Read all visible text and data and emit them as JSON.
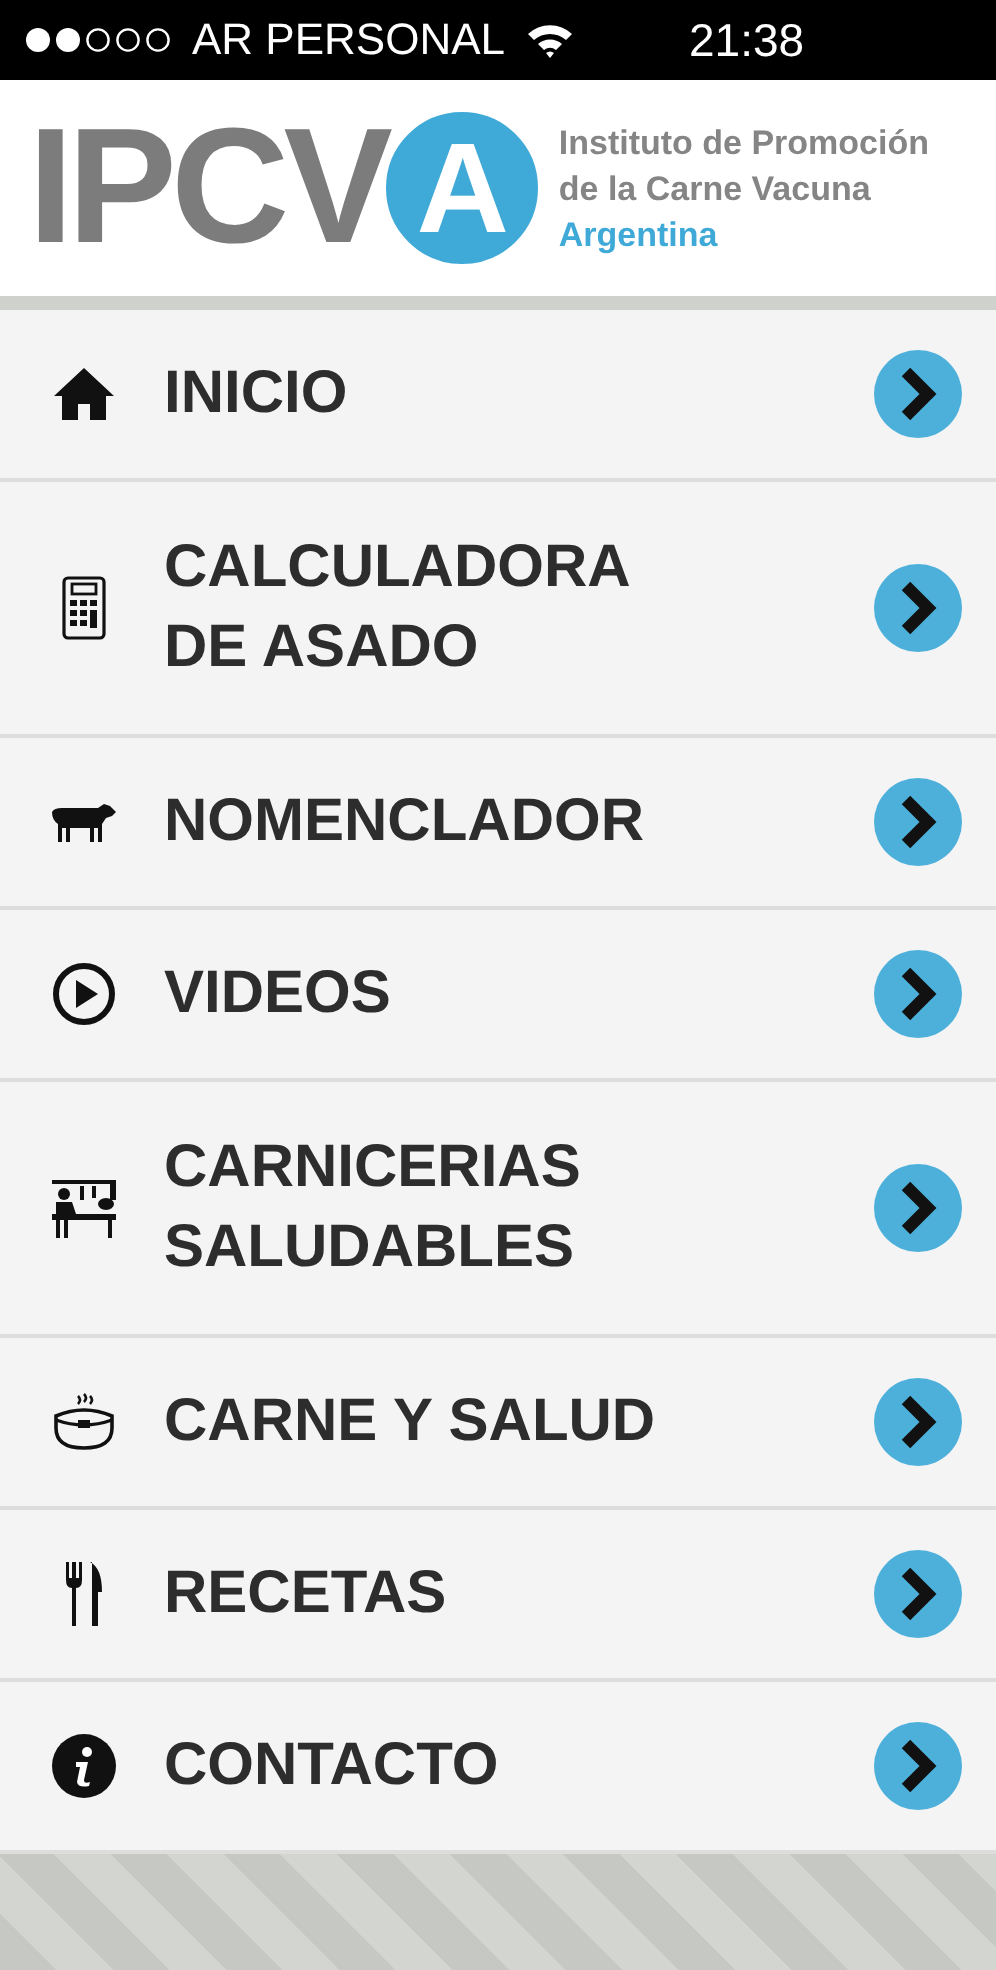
{
  "status_bar": {
    "carrier": "AR PERSONAL",
    "time": "21:38"
  },
  "header": {
    "logo_letters": "IPCV",
    "logo_circle_letter": "A",
    "org_line_1": "Instituto de Promoción",
    "org_line_2": "de la Carne Vacuna",
    "org_line_3": "Argentina"
  },
  "menu": [
    {
      "kind": "home",
      "label": "INICIO"
    },
    {
      "kind": "calculator",
      "label": "CALCULADORA DE ASADO"
    },
    {
      "kind": "cow",
      "label": "NOMENCLADOR"
    },
    {
      "kind": "play",
      "label": "VIDEOS"
    },
    {
      "kind": "butcher",
      "label": "CARNICERIAS SALUDABLES"
    },
    {
      "kind": "pot",
      "label": "CARNE Y SALUD"
    },
    {
      "kind": "cutlery",
      "label": "RECETAS"
    },
    {
      "kind": "info",
      "label": "CONTACTO"
    }
  ]
}
